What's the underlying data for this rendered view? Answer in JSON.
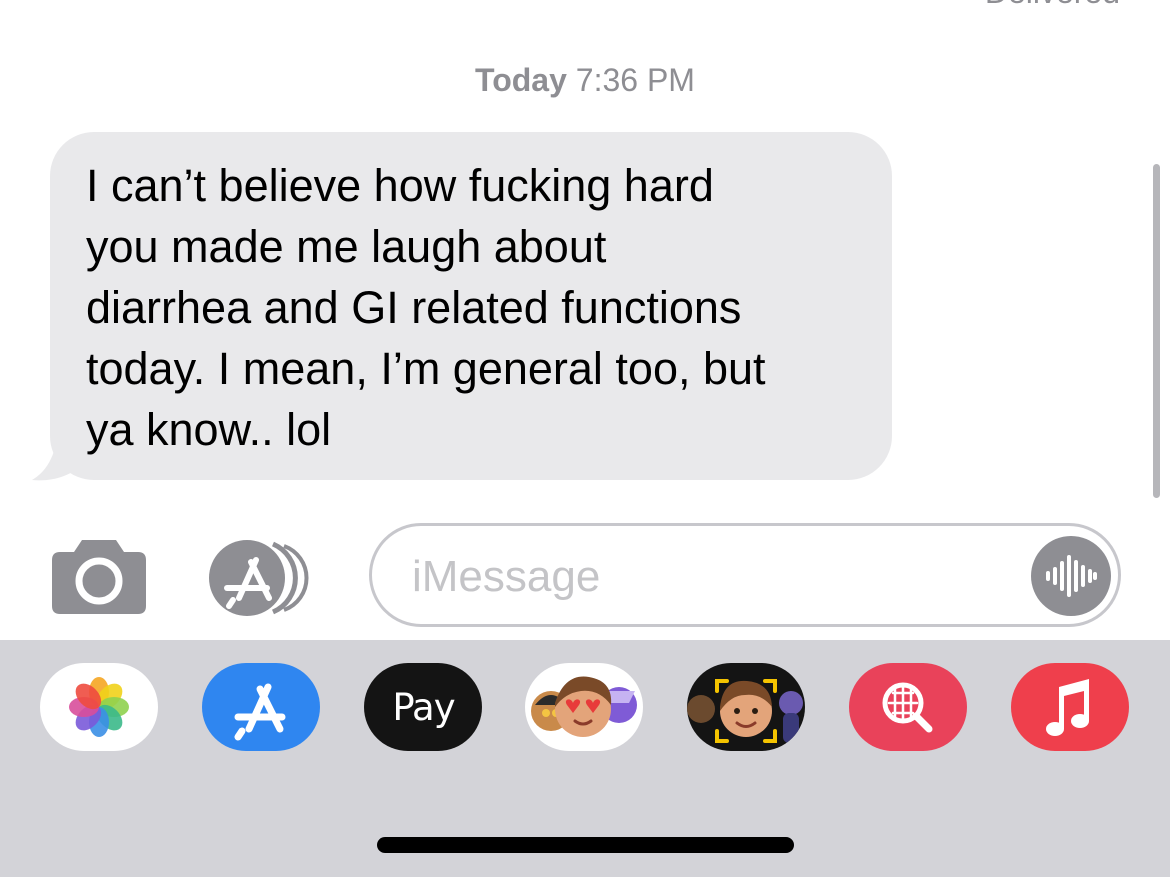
{
  "conversation": {
    "delivered_label": "Delivered",
    "timestamp_day": "Today",
    "timestamp_time": "7:36 PM",
    "messages": [
      {
        "direction": "incoming",
        "text": "I can’t believe how fucking hard\nyou made me laugh about\ndiarrhea and GI related functions\ntoday. I mean, I’m general too, but\nya know.. lol"
      }
    ]
  },
  "compose": {
    "placeholder": "iMessage",
    "camera_icon": "camera-icon",
    "apps_icon": "app-store-icon",
    "audio_icon": "waveform-icon"
  },
  "app_drawer": {
    "apps": [
      {
        "name": "Photos",
        "icon": "photos-icon"
      },
      {
        "name": "App Store",
        "icon": "app-store-icon"
      },
      {
        "name": "Apple Pay",
        "icon": "apple-pay-icon",
        "label": "Pay"
      },
      {
        "name": "Memoji Stickers",
        "icon": "memoji-stickers-icon"
      },
      {
        "name": "Memoji",
        "icon": "memoji-icon"
      },
      {
        "name": "Images",
        "icon": "image-search-icon"
      },
      {
        "name": "Music",
        "icon": "music-note-icon"
      }
    ]
  },
  "colors": {
    "bubble_incoming": "#e9e9eb",
    "secondary_text": "#8e8e93",
    "drawer_background": "#d3d3d8",
    "app_store_blue": "#2f86f0",
    "search_red": "#e9425a",
    "music_red": "#ef3f4c"
  }
}
